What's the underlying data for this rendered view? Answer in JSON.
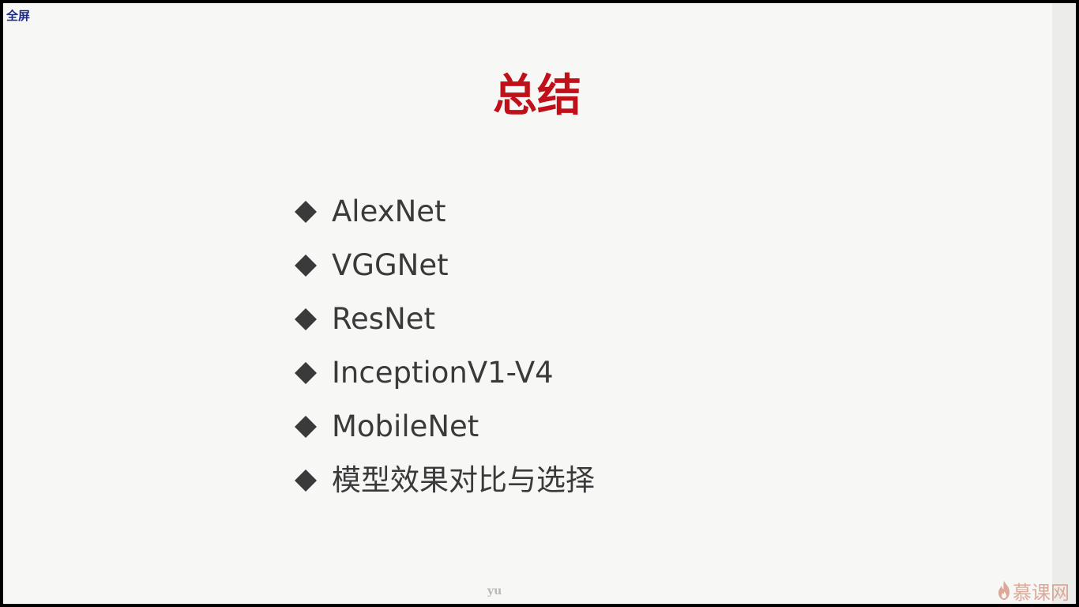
{
  "toolbar": {
    "fullscreen_label": "全屏"
  },
  "slide": {
    "title": "总结",
    "bullets": [
      "AlexNet",
      "VGGNet",
      "ResNet",
      "InceptionV1-V4",
      "MobileNet",
      "模型效果对比与选择"
    ]
  },
  "watermark": {
    "author": "yu",
    "logo_text": "慕课网"
  },
  "colors": {
    "title": "#c0101a",
    "bullet_text": "#3a3a3a",
    "bullet_marker": "#3a3a3a",
    "background": "#f7f7f5",
    "logo": "#d89c8a"
  },
  "icons": {
    "bullet": "diamond-bullet-icon",
    "logo": "flame-icon"
  }
}
